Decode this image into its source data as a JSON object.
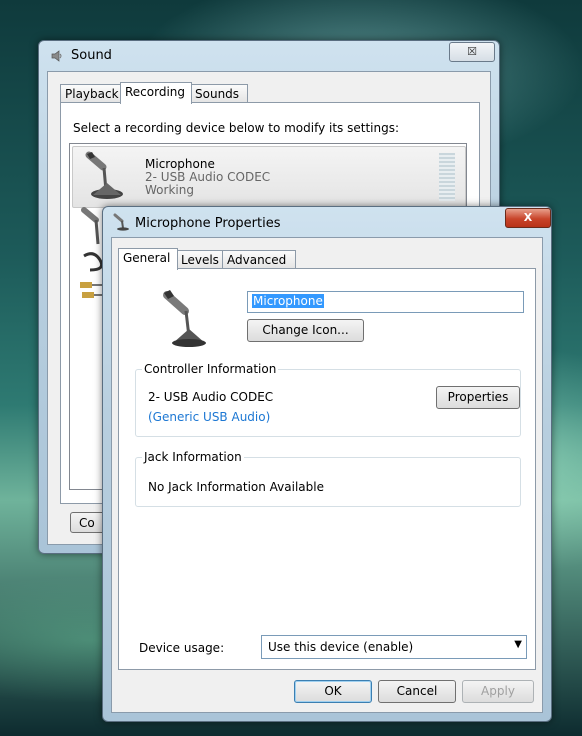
{
  "sound_window": {
    "title": "Sound",
    "close_label": "☒",
    "tabs": [
      {
        "label": "Playback",
        "active": false
      },
      {
        "label": "Recording",
        "active": true
      },
      {
        "label": "Sounds",
        "active": false
      }
    ],
    "instruction": "Select a recording device below to modify its settings:",
    "devices": [
      {
        "name": "Microphone",
        "driver": "2- USB Audio CODEC",
        "status": "Working"
      }
    ],
    "configure_label_partial": "Co"
  },
  "properties_window": {
    "title": "Microphone Properties",
    "close_label": "X",
    "tabs": [
      {
        "label": "General",
        "active": true
      },
      {
        "label": "Levels",
        "active": false
      },
      {
        "label": "Advanced",
        "active": false
      }
    ],
    "name_value": "Microphone",
    "change_icon_label": "Change Icon...",
    "controller": {
      "heading": "Controller Information",
      "name": "2- USB Audio CODEC",
      "driver_link": "(Generic USB Audio)",
      "properties_label": "Properties"
    },
    "jack": {
      "heading": "Jack Information",
      "text": "No Jack Information Available"
    },
    "device_usage": {
      "label": "Device usage:",
      "selected": "Use this device (enable)"
    },
    "buttons": {
      "ok": "OK",
      "cancel": "Cancel",
      "apply": "Apply"
    }
  },
  "icons": {
    "speaker": "speaker-icon",
    "microphone": "microphone-icon"
  },
  "colors": {
    "link": "#1c77d3",
    "selection": "#3399ff",
    "close_red": "#c8442a"
  }
}
